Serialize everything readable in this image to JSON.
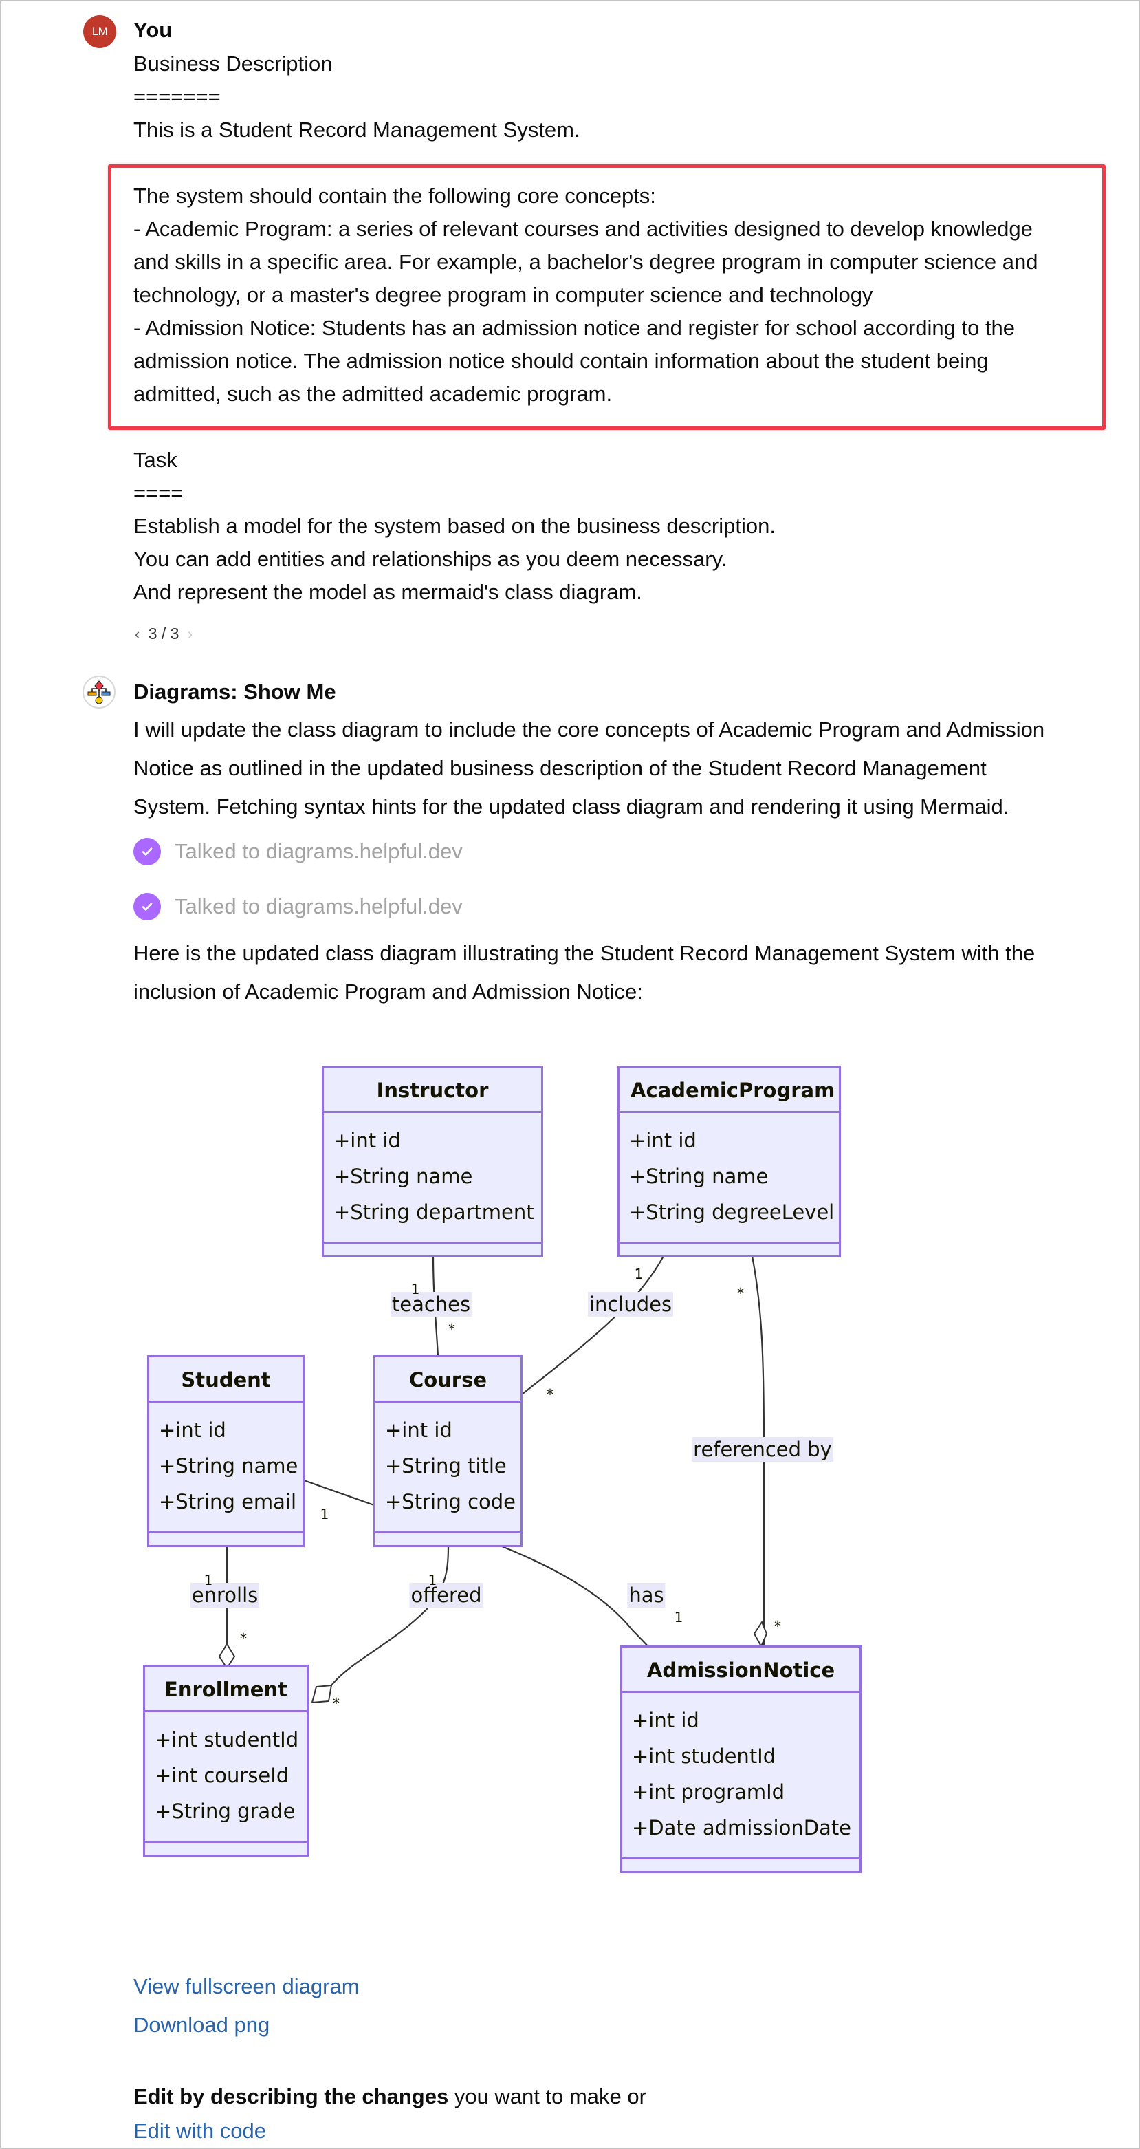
{
  "user_message": {
    "avatar_initials": "LM",
    "author": "You",
    "lines_before": [
      "Business Description",
      "=======",
      "This is a Student Record Management System."
    ],
    "highlighted_lines": [
      "The system should contain the following core concepts:",
      "- Academic Program: a series of relevant courses and activities designed to develop knowledge",
      "and skills in a specific area. For example, a bachelor's degree program in computer science and",
      "technology, or a master's degree program in computer science and technology",
      "- Admission Notice: Students has an admission notice and register for school according to the",
      "admission notice. The admission notice should contain information about the student being",
      "admitted, such as the admitted academic program."
    ],
    "lines_after": [
      "Task",
      "====",
      "Establish a model for the system based on the business description.",
      "You can add entities and relationships as you deem necessary.",
      "And represent the model as mermaid's class diagram."
    ],
    "pager": {
      "current": 3,
      "total": 3,
      "label": "3 / 3"
    },
    "highlight_color": "#f03a47"
  },
  "assistant_message": {
    "author": "Diagrams: Show Me",
    "intro_lines": [
      "I will update the class diagram to include the core concepts of Academic Program and Admission",
      "Notice as outlined in the updated business description of the Student Record Management",
      "System. Fetching syntax hints for the updated class diagram and rendering it using Mermaid."
    ],
    "tool_calls": [
      {
        "label": "Talked to diagrams.helpful.dev",
        "icon": "check-circle-icon"
      },
      {
        "label": "Talked to diagrams.helpful.dev",
        "icon": "check-circle-icon"
      }
    ],
    "outro_lines": [
      "Here is the updated class diagram illustrating the Student Record Management System with the",
      "inclusion of Academic Program and Admission Notice:"
    ],
    "links": {
      "fullscreen": "View fullscreen diagram",
      "download": "Download png",
      "edit_code": "Edit with code"
    },
    "edit_hint": {
      "bold": "Edit by describing the changes",
      "rest": " you want to make or"
    },
    "accent_color": "#ab68ff",
    "link_color": "#2964aa"
  },
  "diagram": {
    "classes": {
      "instructor": {
        "name": "Instructor",
        "attributes": [
          "+int id",
          "+String name",
          "+String department"
        ]
      },
      "academic_program": {
        "name": "AcademicProgram",
        "attributes": [
          "+int id",
          "+String name",
          "+String degreeLevel"
        ]
      },
      "student": {
        "name": "Student",
        "attributes": [
          "+int id",
          "+String name",
          "+String email"
        ]
      },
      "course": {
        "name": "Course",
        "attributes": [
          "+int id",
          "+String title",
          "+String code"
        ]
      },
      "enrollment": {
        "name": "Enrollment",
        "attributes": [
          "+int studentId",
          "+int courseId",
          "+String grade"
        ]
      },
      "admission_notice": {
        "name": "AdmissionNotice",
        "attributes": [
          "+int id",
          "+int studentId",
          "+int programId",
          "+Date admissionDate"
        ]
      }
    },
    "relations": {
      "teaches": {
        "label": "teaches",
        "from": "Instructor",
        "to": "Course",
        "from_card": "1",
        "to_card": "*"
      },
      "includes": {
        "label": "includes",
        "from": "AcademicProgram",
        "to": "Course",
        "from_card": "1",
        "to_card": "*"
      },
      "referenced_by": {
        "label": "referenced by",
        "from": "AcademicProgram",
        "to": "AdmissionNotice",
        "from_card": "*",
        "to_card": "*",
        "aggregation": true
      },
      "student_course": {
        "label": "",
        "from": "Student",
        "to": "Course",
        "to_card": "1"
      },
      "enrolls": {
        "label": "enrolls",
        "from": "Student",
        "to": "Enrollment",
        "from_card": "1",
        "to_card": "*",
        "aggregation": true
      },
      "offered": {
        "label": "offered",
        "from": "Course",
        "to": "Enrollment",
        "from_card": "1",
        "to_card": "*",
        "aggregation": true
      },
      "has": {
        "label": "has",
        "from": "Course",
        "to": "AdmissionNotice",
        "to_card": "1"
      }
    },
    "colors": {
      "fill": "#ececff",
      "stroke": "#9370db",
      "line": "#333333"
    }
  }
}
